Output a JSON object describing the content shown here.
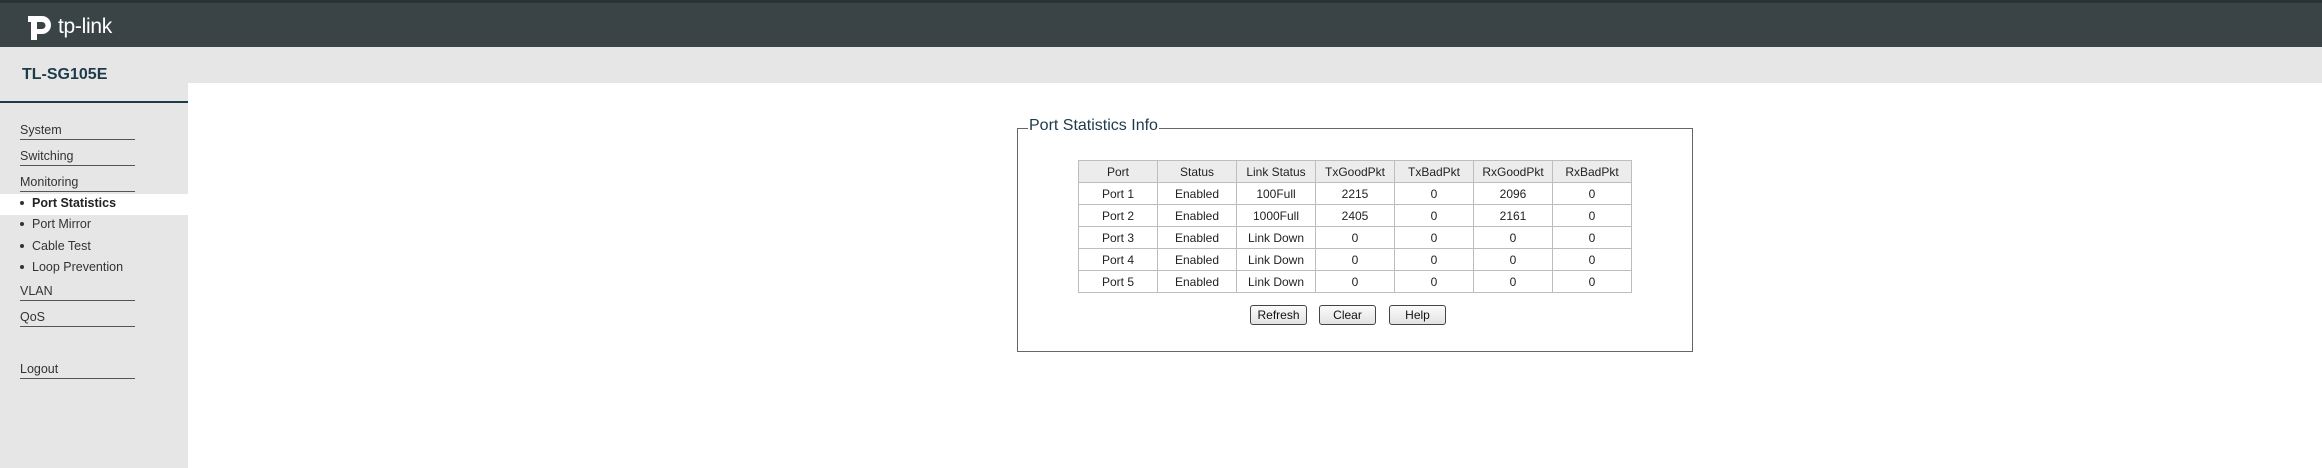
{
  "header": {
    "logo_text": "tp-link",
    "device_name": "TL-SG105E"
  },
  "sidebar": {
    "items": [
      {
        "label": "System"
      },
      {
        "label": "Switching"
      },
      {
        "label": "Monitoring"
      },
      {
        "label": "VLAN"
      },
      {
        "label": "QoS"
      },
      {
        "label": "Logout"
      }
    ],
    "monitoring_sub": [
      {
        "label": "Port Statistics",
        "active": true
      },
      {
        "label": "Port Mirror"
      },
      {
        "label": "Cable Test"
      },
      {
        "label": "Loop Prevention"
      }
    ]
  },
  "panel": {
    "title": "Port Statistics Info",
    "columns": [
      "Port",
      "Status",
      "Link Status",
      "TxGoodPkt",
      "TxBadPkt",
      "RxGoodPkt",
      "RxBadPkt"
    ],
    "rows": [
      [
        "Port 1",
        "Enabled",
        "100Full",
        "2215",
        "0",
        "2096",
        "0"
      ],
      [
        "Port 2",
        "Enabled",
        "1000Full",
        "2405",
        "0",
        "2161",
        "0"
      ],
      [
        "Port 3",
        "Enabled",
        "Link Down",
        "0",
        "0",
        "0",
        "0"
      ],
      [
        "Port 4",
        "Enabled",
        "Link Down",
        "0",
        "0",
        "0",
        "0"
      ],
      [
        "Port 5",
        "Enabled",
        "Link Down",
        "0",
        "0",
        "0",
        "0"
      ]
    ],
    "buttons": {
      "refresh": "Refresh",
      "clear": "Clear",
      "help": "Help"
    }
  },
  "colors": {
    "topbar": "#3a4447",
    "sidebar_bg": "#e6e6e6",
    "accent": "#1f3b4a"
  }
}
